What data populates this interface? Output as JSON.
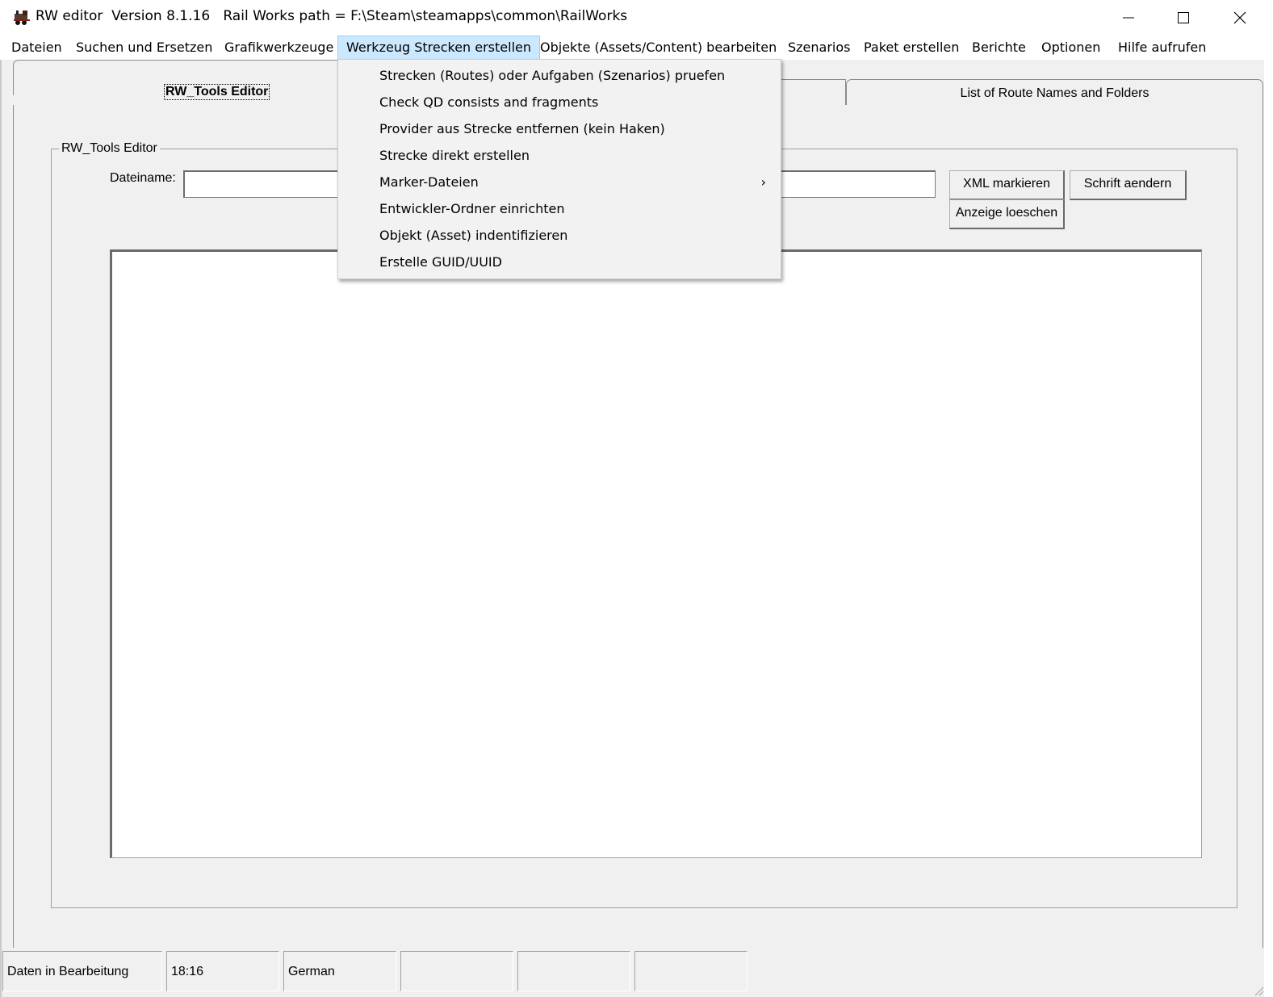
{
  "window": {
    "title": "RW editor  Version 8.1.16   Rail Works path = F:\\Steam\\steamapps\\common\\RailWorks"
  },
  "menubar": {
    "items": [
      {
        "label": "Dateien"
      },
      {
        "label": "Suchen und Ersetzen"
      },
      {
        "label": "Grafikwerkzeuge"
      },
      {
        "label": "Werkzeug Strecken erstellen",
        "active": true
      },
      {
        "label": "Objekte (Assets/Content) bearbeiten"
      },
      {
        "label": "Szenarios"
      },
      {
        "label": "Paket erstellen"
      },
      {
        "label": "Berichte"
      },
      {
        "label": "Optionen"
      },
      {
        "label": "Hilfe aufrufen"
      }
    ]
  },
  "dropdown": {
    "items": [
      {
        "label": "Strecken (Routes) oder Aufgaben (Szenarios) pruefen"
      },
      {
        "label": "Check QD consists and fragments"
      },
      {
        "label": "Provider aus Strecke entfernen (kein Haken)"
      },
      {
        "label": "Strecke direkt erstellen"
      },
      {
        "label": "Marker-Dateien",
        "submenu_arrow": "›"
      },
      {
        "label": "Entwickler-Ordner einrichten"
      },
      {
        "label": "Objekt (Asset) indentifizieren"
      },
      {
        "label": "Erstelle GUID/UUID"
      }
    ]
  },
  "tabs": {
    "active_label": "RW_Tools Editor",
    "right_label": "List of Route Names and Folders"
  },
  "editor": {
    "group_title": "RW_Tools Editor",
    "filename_label": "Dateiname:",
    "filename_value": "",
    "buttons": {
      "xml": "XML markieren",
      "font": "Schrift aendern",
      "clear": "Anzeige loeschen"
    }
  },
  "statusbar": {
    "cells": [
      "Daten in Bearbeitung",
      "18:16",
      "German",
      "",
      "",
      ""
    ]
  },
  "icons": {
    "app": "locomotive-icon",
    "minimize": "minimize-icon",
    "maximize": "maximize-icon",
    "close": "close-icon"
  },
  "colors": {
    "menu_active_bg": "#cce8ff",
    "menu_active_border": "#99d1ff",
    "background": "#f0f0f0"
  }
}
